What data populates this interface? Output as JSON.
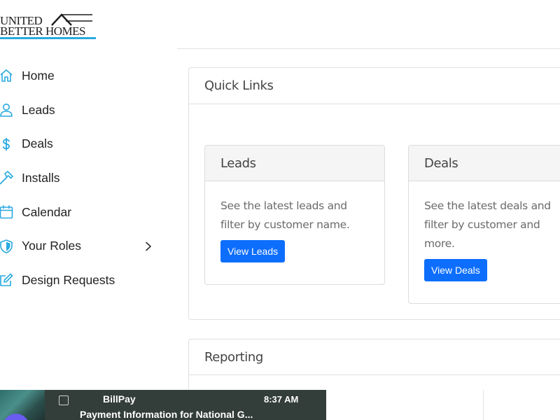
{
  "logo": {
    "line1": "UNITED",
    "line2": "BETTER HOMES",
    "accent_color": "#29a9e0"
  },
  "sidebar": {
    "icon_color": "#29a9e0",
    "items": [
      {
        "label": "Home",
        "icon": "home-icon"
      },
      {
        "label": "Leads",
        "icon": "user-icon"
      },
      {
        "label": "Deals",
        "icon": "dollar-icon"
      },
      {
        "label": "Installs",
        "icon": "hammer-icon"
      },
      {
        "label": "Calendar",
        "icon": "calendar-icon"
      },
      {
        "label": "Your Roles",
        "icon": "shield-icon",
        "has_submenu": true
      },
      {
        "label": "Design Requests",
        "icon": "edit-icon"
      }
    ]
  },
  "quick_links": {
    "title": "Quick Links",
    "cards": [
      {
        "title": "Leads",
        "description": "See the latest leads and filter by customer name.",
        "button": "View Leads"
      },
      {
        "title": "Deals",
        "description": "See the latest deals and filter by customer and more.",
        "button": "View Deals"
      }
    ]
  },
  "reporting": {
    "title": "Reporting"
  },
  "notification": {
    "sender": "BillPay",
    "time": "8:37 AM",
    "subject": "Payment Information for National G..."
  },
  "colors": {
    "primary_button": "#0d6efd",
    "notification_bg": "#333d3a"
  }
}
